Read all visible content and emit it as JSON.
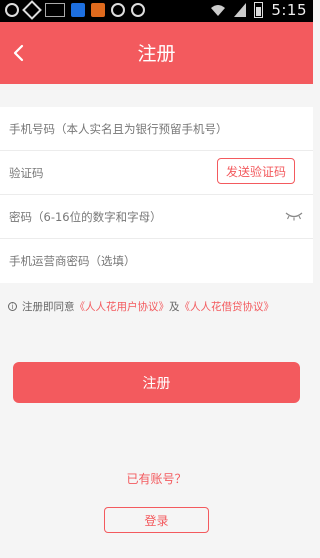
{
  "status_bar": {
    "time": "5:15"
  },
  "header": {
    "title": "注册"
  },
  "form": {
    "phone_placeholder": "手机号码（本人实名且为银行预留手机号）",
    "code_label": "验证码",
    "send_code_label": "发送验证码",
    "password_placeholder": "密码（6-16位的数字和字母）",
    "carrier_password_placeholder": "手机运营商密码（选填）"
  },
  "agreement": {
    "prefix": "注册即同意",
    "user_agreement": "《人人花用户协议》",
    "and": "及",
    "loan_agreement": "《人人花借贷协议》"
  },
  "actions": {
    "register_label": "注册",
    "have_account": "已有账号？",
    "login_label": "登录"
  },
  "colors": {
    "brand": "#f35a5e"
  }
}
